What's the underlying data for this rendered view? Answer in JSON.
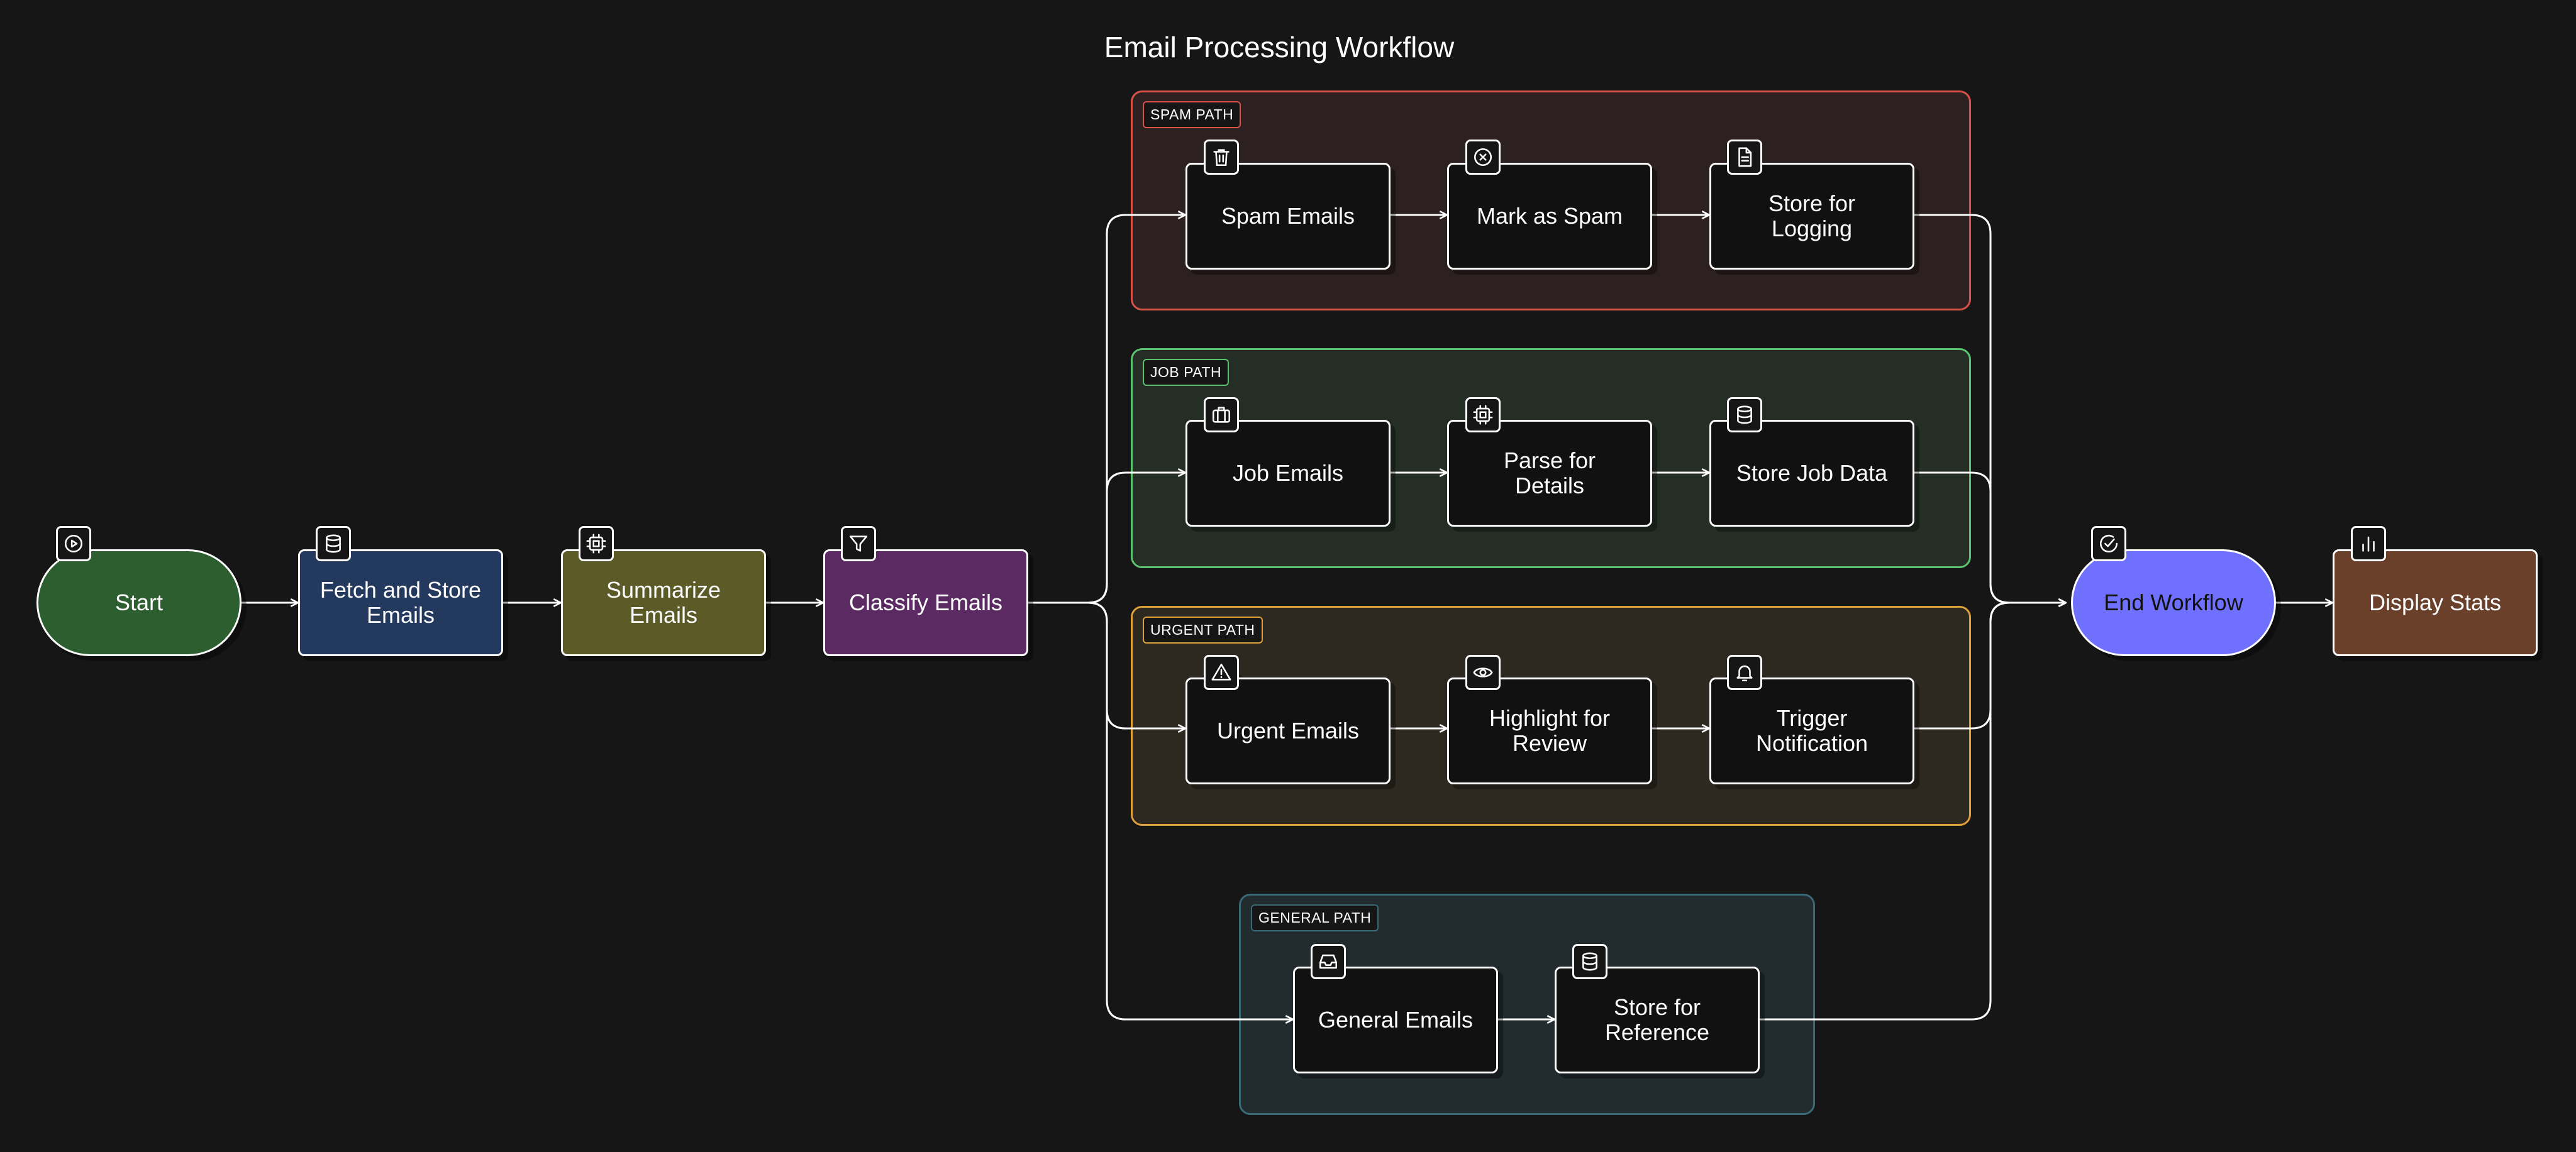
{
  "title": "Email Processing Workflow",
  "colors": {
    "start": "#2d5e2f",
    "fetch": "#233a5e",
    "summarize": "#5c5b27",
    "classify": "#5c2a63",
    "end": "#7070ff",
    "display": "#6a402b",
    "dark_node": "#111111",
    "spam_border": "#d9524a",
    "job_border": "#5cc26f",
    "urgent_border": "#e0a03a",
    "general_border": "#3a6a78"
  },
  "groups": {
    "spam": "SPAM PATH",
    "job": "JOB PATH",
    "urgent": "URGENT PATH",
    "general": "GENERAL PATH"
  },
  "nodes": {
    "start": "Start",
    "fetch": "Fetch and Store\nEmails",
    "summarize": "Summarize\nEmails",
    "classify": "Classify Emails",
    "spam_emails": "Spam Emails",
    "mark_spam": "Mark as Spam",
    "store_logging": "Store for\nLogging",
    "job_emails": "Job Emails",
    "parse_details": "Parse for\nDetails",
    "store_job": "Store Job Data",
    "urgent_emails": "Urgent Emails",
    "highlight_review": "Highlight for\nReview",
    "trigger_notification": "Trigger\nNotification",
    "general_emails": "General Emails",
    "store_reference": "Store for\nReference",
    "end": "End Workflow",
    "display_stats": "Display Stats"
  },
  "icons": {
    "start": "play-icon",
    "fetch": "database-icon",
    "summarize": "cpu-icon",
    "classify": "filter-icon",
    "spam_emails": "trash-icon",
    "mark_spam": "x-circle-icon",
    "store_logging": "file-text-icon",
    "job_emails": "briefcase-icon",
    "parse_details": "cpu-icon",
    "store_job": "database-icon",
    "urgent_emails": "alert-triangle-icon",
    "highlight_review": "eye-icon",
    "trigger_notification": "bell-icon",
    "general_emails": "inbox-icon",
    "store_reference": "database-icon",
    "end": "check-circle-icon",
    "display_stats": "bar-chart-icon"
  }
}
